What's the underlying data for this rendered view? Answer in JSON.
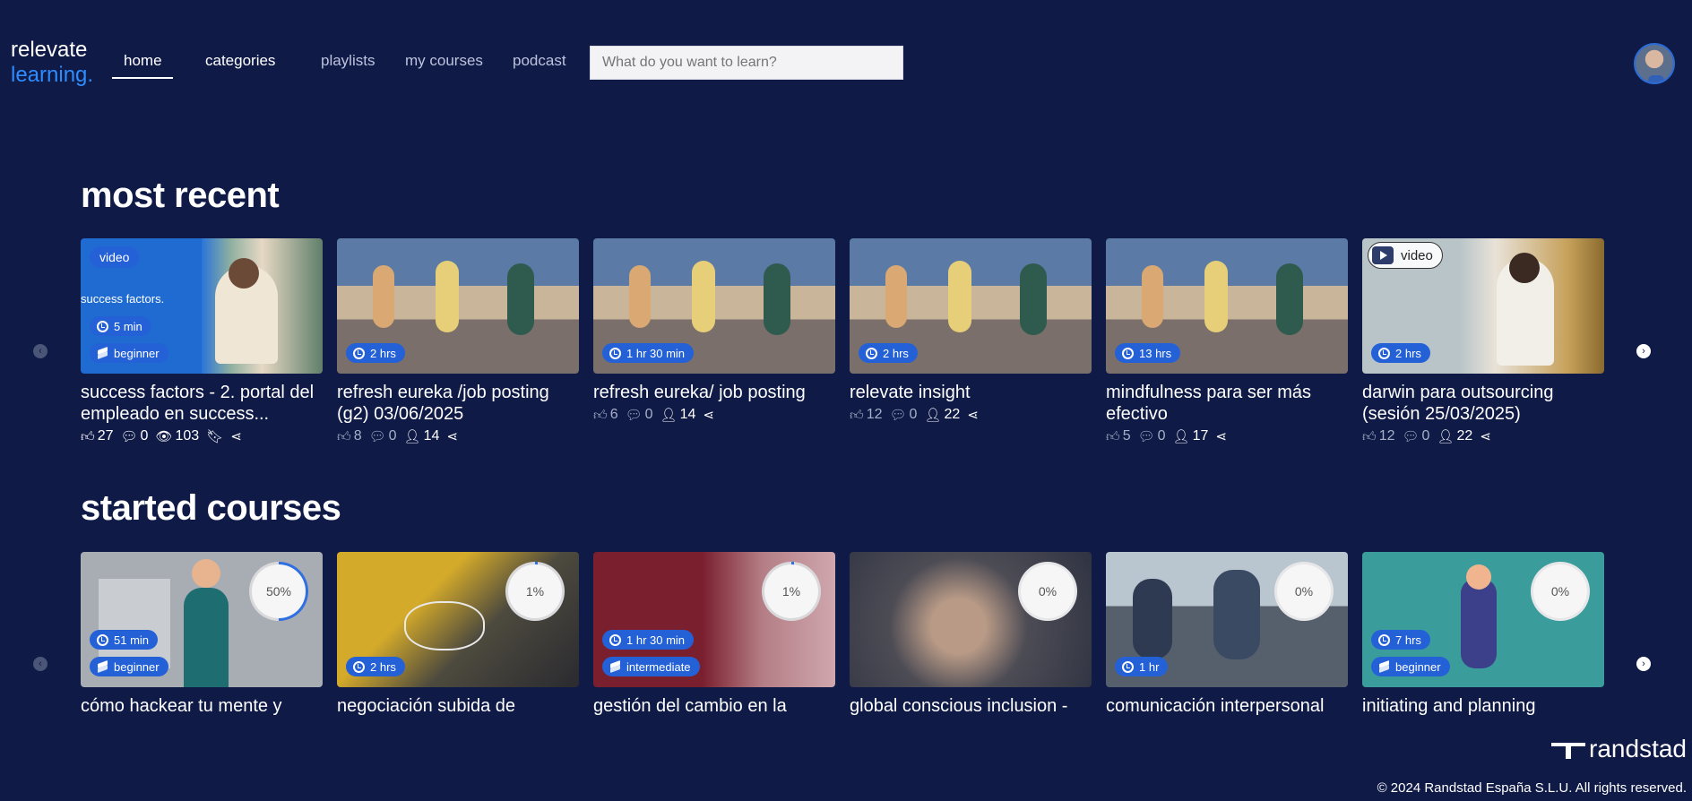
{
  "logo": {
    "line1": "relevate",
    "line2": "learning."
  },
  "nav": [
    {
      "label": "home",
      "active": true
    },
    {
      "label": "categories",
      "active": false
    },
    {
      "label": "playlists",
      "active": false
    },
    {
      "label": "my courses",
      "active": false
    },
    {
      "label": "podcast",
      "active": false
    }
  ],
  "search": {
    "placeholder": "What do you want to learn?"
  },
  "sections": {
    "recent": {
      "title": "most recent",
      "cards": [
        {
          "title": "success factors - 2. portal del empleado en success...",
          "video": "video",
          "thumb_text": "success factors.",
          "duration": "5 min",
          "level": "beginner",
          "likes": "27",
          "comments": "0",
          "views": "103",
          "bookmark": true
        },
        {
          "title": "refresh eureka /job posting (g2) 03/06/2025",
          "duration": "2 hrs",
          "likes": "8",
          "comments": "0",
          "users": "14"
        },
        {
          "title": "refresh eureka/ job posting",
          "duration": "1 hr 30 min",
          "likes": "6",
          "comments": "0",
          "users": "14"
        },
        {
          "title": "relevate insight",
          "duration": "2 hrs",
          "likes": "12",
          "comments": "0",
          "users": "22"
        },
        {
          "title": "mindfulness para ser más efectivo",
          "duration": "13 hrs",
          "likes": "5",
          "comments": "0",
          "users": "17"
        },
        {
          "title": "darwin para outsourcing (sesión 25/03/2025)",
          "video": "video",
          "duration": "2 hrs",
          "likes": "12",
          "comments": "0",
          "users": "22"
        }
      ]
    },
    "started": {
      "title": "started courses",
      "cards": [
        {
          "title": "cómo hackear tu mente y",
          "duration": "51 min",
          "level": "beginner",
          "progress": "50%"
        },
        {
          "title": "negociación subida de",
          "duration": "2 hrs",
          "progress": "1%"
        },
        {
          "title": "gestión del cambio en la",
          "duration": "1 hr 30 min",
          "level": "intermediate",
          "progress": "1%"
        },
        {
          "title": "global conscious inclusion -",
          "progress": "0%"
        },
        {
          "title": "comunicación interpersonal",
          "duration": "1 hr",
          "progress": "0%"
        },
        {
          "title": "initiating and planning",
          "duration": "7 hrs",
          "level": "beginner",
          "progress": "0%"
        }
      ]
    }
  },
  "footer": {
    "brand": "randstad",
    "copyright": "© 2024 Randstad España S.L.U. All rights reserved."
  },
  "colors": {
    "background": "#0f1a47",
    "accent": "#2461d7",
    "logo_blue": "#2f8cff"
  }
}
